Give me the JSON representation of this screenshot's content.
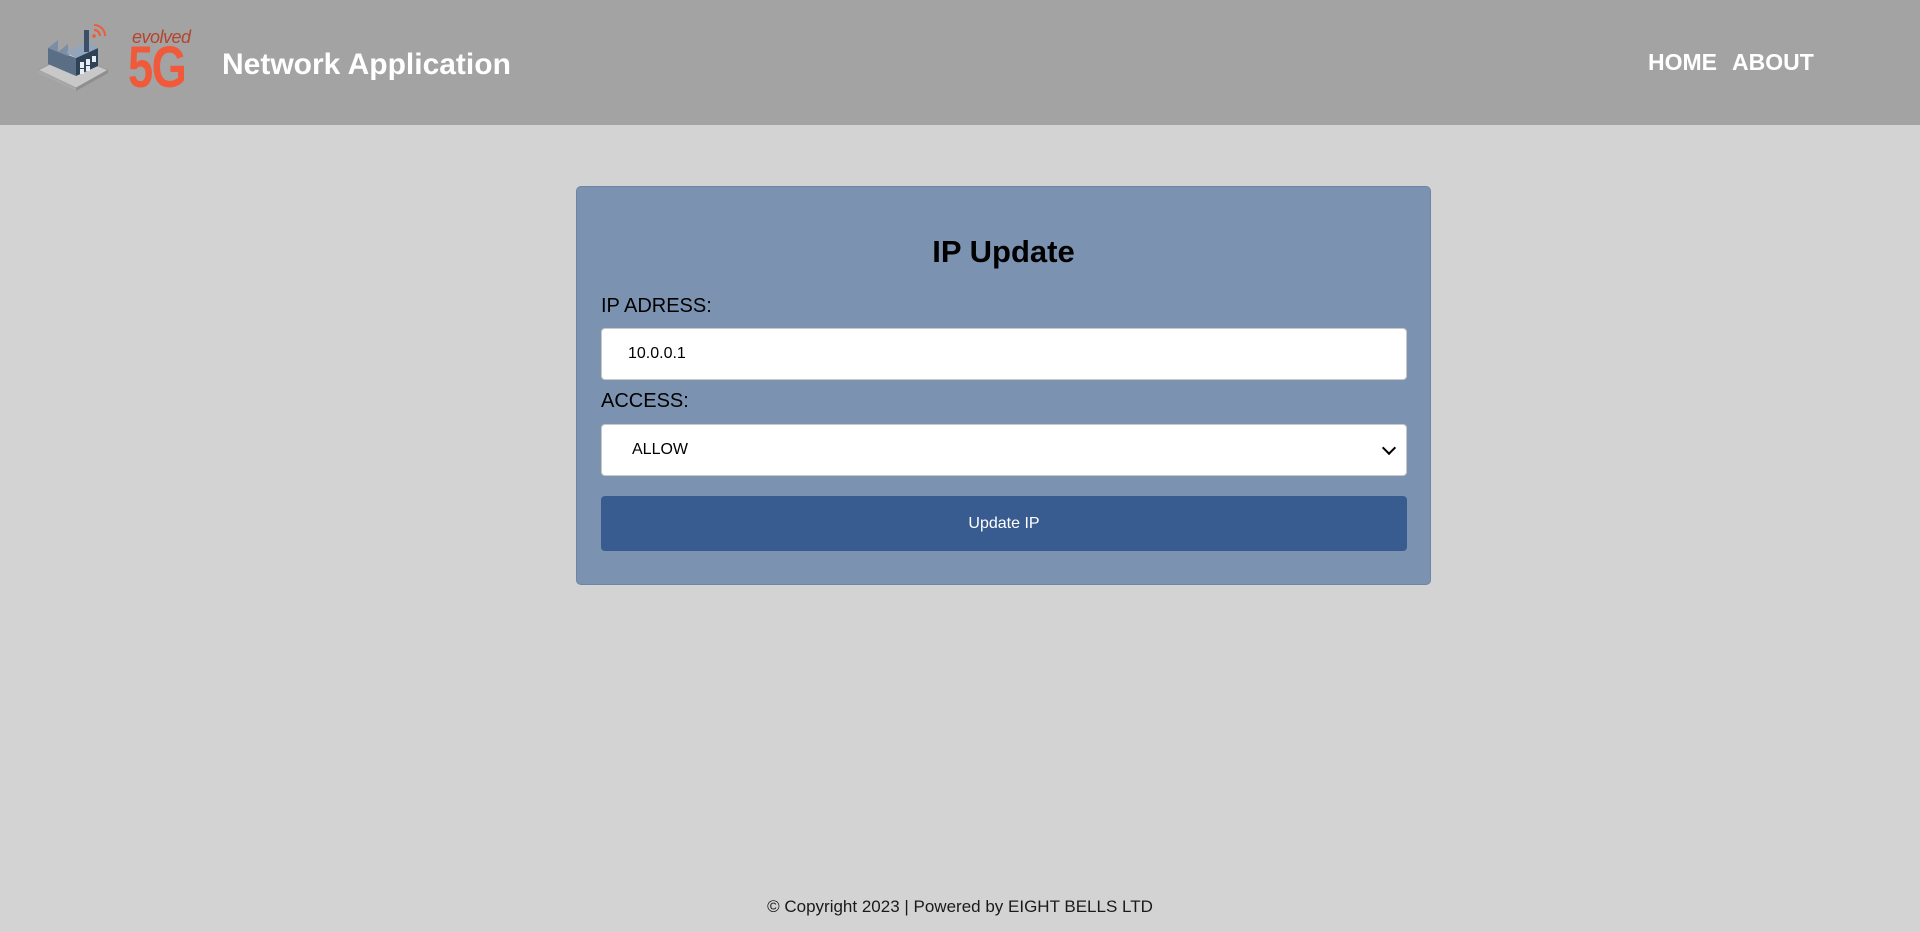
{
  "header": {
    "logo": {
      "text_small": "evolved",
      "text_large": "5G",
      "icon": "factory-icon"
    },
    "app_title": "Network Application",
    "nav": [
      {
        "label": "HOME"
      },
      {
        "label": "ABOUT"
      }
    ]
  },
  "form": {
    "title": "IP Update",
    "ip_label": "IP ADRESS:",
    "ip_value": "10.0.0.1",
    "access_label": "ACCESS:",
    "access_selected": "ALLOW",
    "submit_label": "Update IP"
  },
  "footer": {
    "text": "© Copyright 2023 | Powered by EIGHT BELLS LTD"
  },
  "colors": {
    "header_bg": "#a3a3a3",
    "page_bg": "#d3d3d3",
    "card_bg": "#7c92b1",
    "button_bg": "#385c8f",
    "logo_accent": "#f05a3a"
  }
}
